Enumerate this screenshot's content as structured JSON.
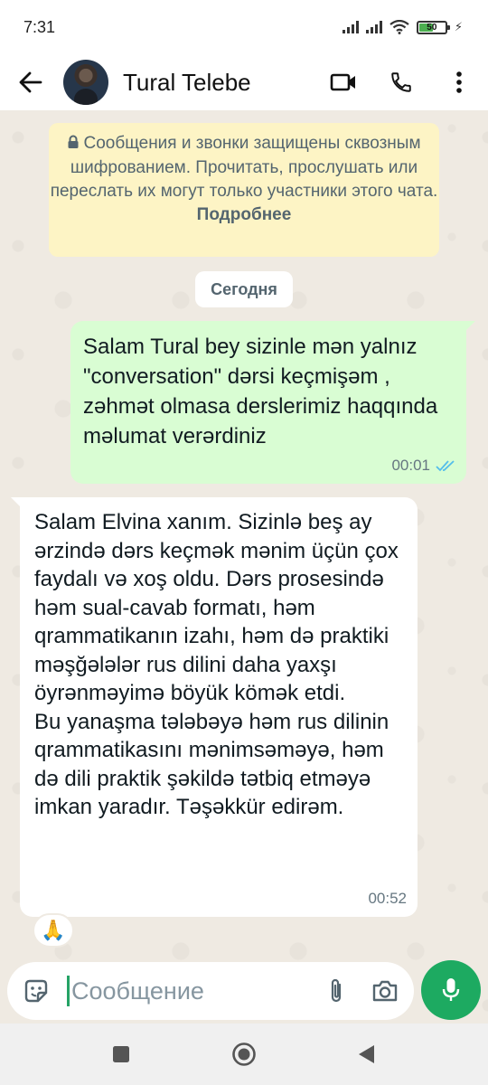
{
  "status_bar": {
    "time": "7:31",
    "battery": "50",
    "icons": [
      "signal-icon",
      "signal-icon",
      "wifi-icon",
      "battery-icon",
      "charging-icon"
    ]
  },
  "header": {
    "contact_name": "Tural Telebe",
    "icons": [
      "back-arrow-icon",
      "video-call-icon",
      "voice-call-icon",
      "more-vert-icon"
    ]
  },
  "encryption_notice": {
    "text": "Сообщения и звонки защищены сквозным шифрованием. Прочитать, прослушать или переслать их могут только участники этого чата.",
    "more_link": "Подробнее"
  },
  "date_separator": "Сегодня",
  "messages": [
    {
      "direction": "outgoing",
      "text": "Salam Tural bey sizinle mən yalnız \"conversation\" dərsi keçmişəm , zəhmət olmasa derslerimiz haqqında məlumat verərdiniz",
      "time": "00:01",
      "status": "read"
    },
    {
      "direction": "incoming",
      "text": "Salam Elvina xanım. Sizinlə beş ay ərzində dərs keçmək mənim üçün çox faydalı və xoş oldu. Dərs prosesində həm sual-cavab formatı, həm qrammatikanın izahı, həm də praktiki məşğələlər rus dilini daha yaxşı öyrənməyimə böyük kömək etdi.\nBu yanaşma tələbəyə həm rus dilinin qrammatikasını mənimsəməyə, həm də dili praktik şəkildə tətbiq etməyə imkan yaradır. Təşəkkür edirəm.",
      "time": "00:52",
      "reaction": "🙏"
    }
  ],
  "composer": {
    "placeholder": "Сообщение",
    "icons": [
      "emoji-icon",
      "attach-icon",
      "camera-icon",
      "mic-icon"
    ]
  },
  "nav_bar": {
    "icons": [
      "recents-icon",
      "home-icon",
      "back-icon"
    ]
  },
  "colors": {
    "outgoing_bubble": "#d9fdd3",
    "incoming_bubble": "#ffffff",
    "chat_background": "#efeae2",
    "notice_background": "#fdf4c5",
    "accent": "#1daa61",
    "read_tick": "#53bdeb"
  }
}
